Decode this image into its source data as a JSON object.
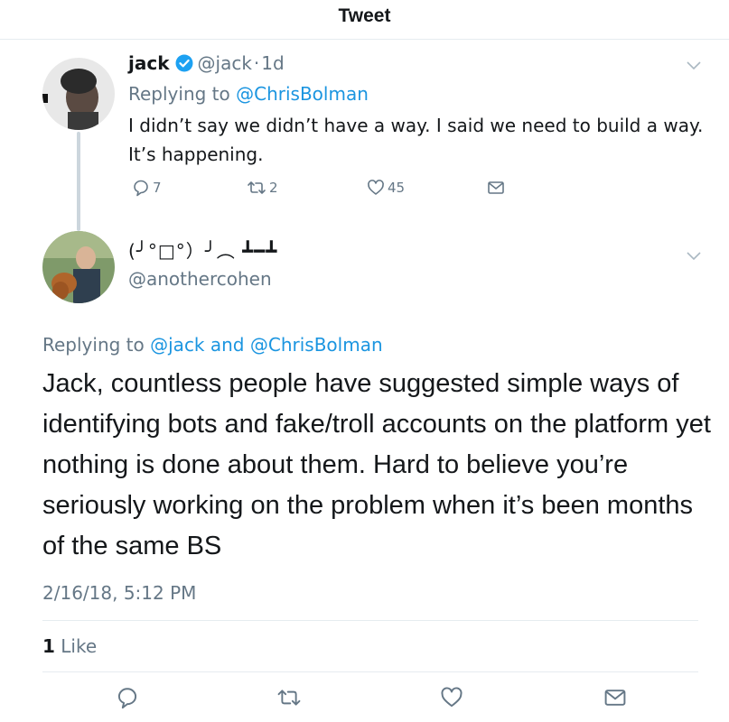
{
  "header": {
    "title": "Tweet"
  },
  "tweet1": {
    "name": "jack",
    "handle": "@jack",
    "separator": "·",
    "time": "1d",
    "replying_prefix": "Replying to",
    "replying_to": "@ChrisBolman",
    "text": "I didn’t say we didn’t have a way. I said we need to build a way. It’s happening.",
    "replies": "7",
    "retweets": "2",
    "likes": "45"
  },
  "tweet2": {
    "name": "(╯°□°）╯︵ ┻━┻",
    "handle": "@anothercohen",
    "replying_prefix": "Replying to",
    "replying_to_1": "@jack",
    "replying_and": "and",
    "replying_to_2": "@ChrisBolman",
    "text": "Jack, countless people have suggested simple ways of identifying bots and fake/troll accounts on the platform yet nothing is done about them. Hard to believe you’re seriously working on the problem when it’s been months of the same BS",
    "timestamp": "2/16/18, 5:12 PM",
    "like_count": "1",
    "like_label": "Like"
  },
  "icons": {
    "verified": "verified-badge-icon",
    "caret": "chevron-down-icon",
    "reply": "reply-icon",
    "retweet": "retweet-icon",
    "like": "heart-icon",
    "dm": "envelope-icon"
  },
  "colors": {
    "link": "#1b95e0",
    "secondary_text": "#657786",
    "primary_text": "#14171a",
    "divider": "#e6ecf0"
  }
}
